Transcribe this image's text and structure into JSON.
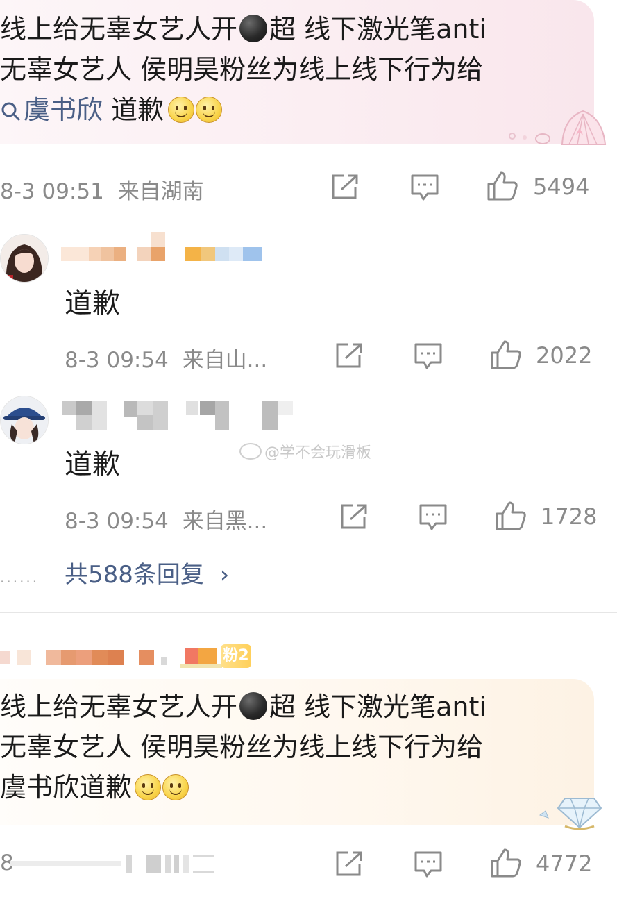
{
  "post": {
    "line1": "线上给无辜女艺人开",
    "line1_after": "超 线下激光笔anti",
    "line2": "无辜女艺人 侯明昊粉丝为线上线下行为给",
    "topic": "虞书欣",
    "line3_after": " 道歉",
    "time": "8-3 09:51",
    "location": "来自湖南",
    "likes": "5494"
  },
  "comments": [
    {
      "text": "道歉",
      "time": "8-3 09:54",
      "location": "来自山...",
      "likes": "2022"
    },
    {
      "text": "道歉",
      "time": "8-3 09:54",
      "location": "来自黑...",
      "likes": "1728"
    }
  ],
  "dots": "......",
  "replies_label": "共588条回复",
  "replies_chevron": "›",
  "watermark": "@学不会玩滑板",
  "second_post": {
    "fan_badge": "粉2",
    "line1": "线上给无辜女艺人开",
    "line1_after": "超 线下激光笔anti",
    "line2": "无辜女艺人 侯明昊粉丝为线上线下行为给",
    "line3": "虞书欣道歉",
    "time_partial": "8",
    "likes": "4772"
  },
  "icons": [
    "share-icon",
    "comment-icon",
    "like-icon",
    "search-icon",
    "smile-emoji",
    "black-circle-emoji",
    "chevron-right-icon"
  ],
  "colors": {
    "topic": "#4a5f86",
    "meta": "#8a8a8a"
  }
}
